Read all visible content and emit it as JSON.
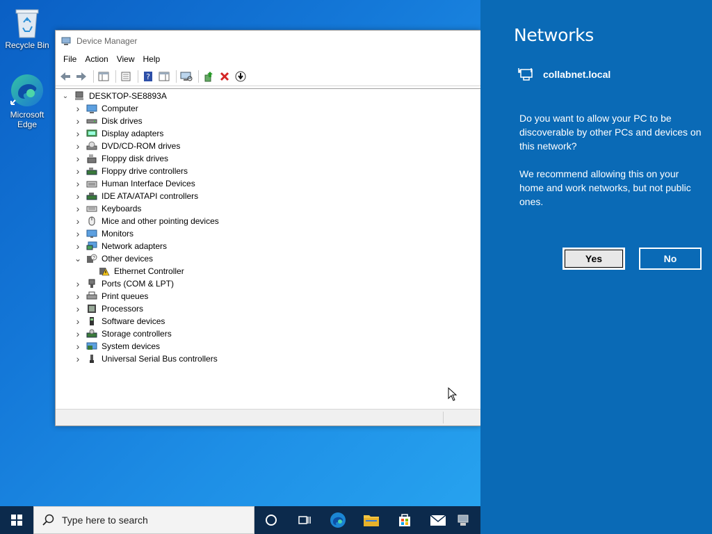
{
  "desktop": {
    "icons": [
      {
        "label": "Recycle Bin",
        "icon": "recycle-bin-icon"
      },
      {
        "label": "Microsoft Edge",
        "icon": "edge-icon"
      }
    ]
  },
  "device_manager": {
    "title": "Device Manager",
    "menu": [
      "File",
      "Action",
      "View",
      "Help"
    ],
    "root": "DESKTOP-SE8893A",
    "categories": [
      {
        "label": "Computer",
        "expanded": false,
        "icon": "computer-icon"
      },
      {
        "label": "Disk drives",
        "expanded": false,
        "icon": "disk-icon"
      },
      {
        "label": "Display adapters",
        "expanded": false,
        "icon": "display-icon"
      },
      {
        "label": "DVD/CD-ROM drives",
        "expanded": false,
        "icon": "dvd-icon"
      },
      {
        "label": "Floppy disk drives",
        "expanded": false,
        "icon": "floppy-icon"
      },
      {
        "label": "Floppy drive controllers",
        "expanded": false,
        "icon": "controller-icon"
      },
      {
        "label": "Human Interface Devices",
        "expanded": false,
        "icon": "hid-icon"
      },
      {
        "label": "IDE ATA/ATAPI controllers",
        "expanded": false,
        "icon": "ide-icon"
      },
      {
        "label": "Keyboards",
        "expanded": false,
        "icon": "keyboard-icon"
      },
      {
        "label": "Mice and other pointing devices",
        "expanded": false,
        "icon": "mouse-icon"
      },
      {
        "label": "Monitors",
        "expanded": false,
        "icon": "monitor-icon"
      },
      {
        "label": "Network adapters",
        "expanded": false,
        "icon": "network-icon"
      },
      {
        "label": "Other devices",
        "expanded": true,
        "icon": "unknown-device-icon"
      },
      {
        "label": "Ethernet Controller",
        "child": true,
        "icon": "warning-device-icon"
      },
      {
        "label": "Ports (COM & LPT)",
        "expanded": false,
        "icon": "port-icon"
      },
      {
        "label": "Print queues",
        "expanded": false,
        "icon": "printer-icon"
      },
      {
        "label": "Processors",
        "expanded": false,
        "icon": "processor-icon"
      },
      {
        "label": "Software devices",
        "expanded": false,
        "icon": "software-device-icon"
      },
      {
        "label": "Storage controllers",
        "expanded": false,
        "icon": "storage-icon"
      },
      {
        "label": "System devices",
        "expanded": false,
        "icon": "system-icon"
      },
      {
        "label": "Universal Serial Bus controllers",
        "expanded": false,
        "icon": "usb-icon"
      }
    ]
  },
  "networks": {
    "title": "Networks",
    "network_name": "collabnet.local",
    "question": "Do you want to allow your PC to be discoverable by other PCs and devices on this network?",
    "recommendation": "We recommend allowing this on your home and work networks, but not public ones.",
    "yes_label": "Yes",
    "no_label": "No"
  },
  "taskbar": {
    "search_placeholder": "Type here to search"
  }
}
